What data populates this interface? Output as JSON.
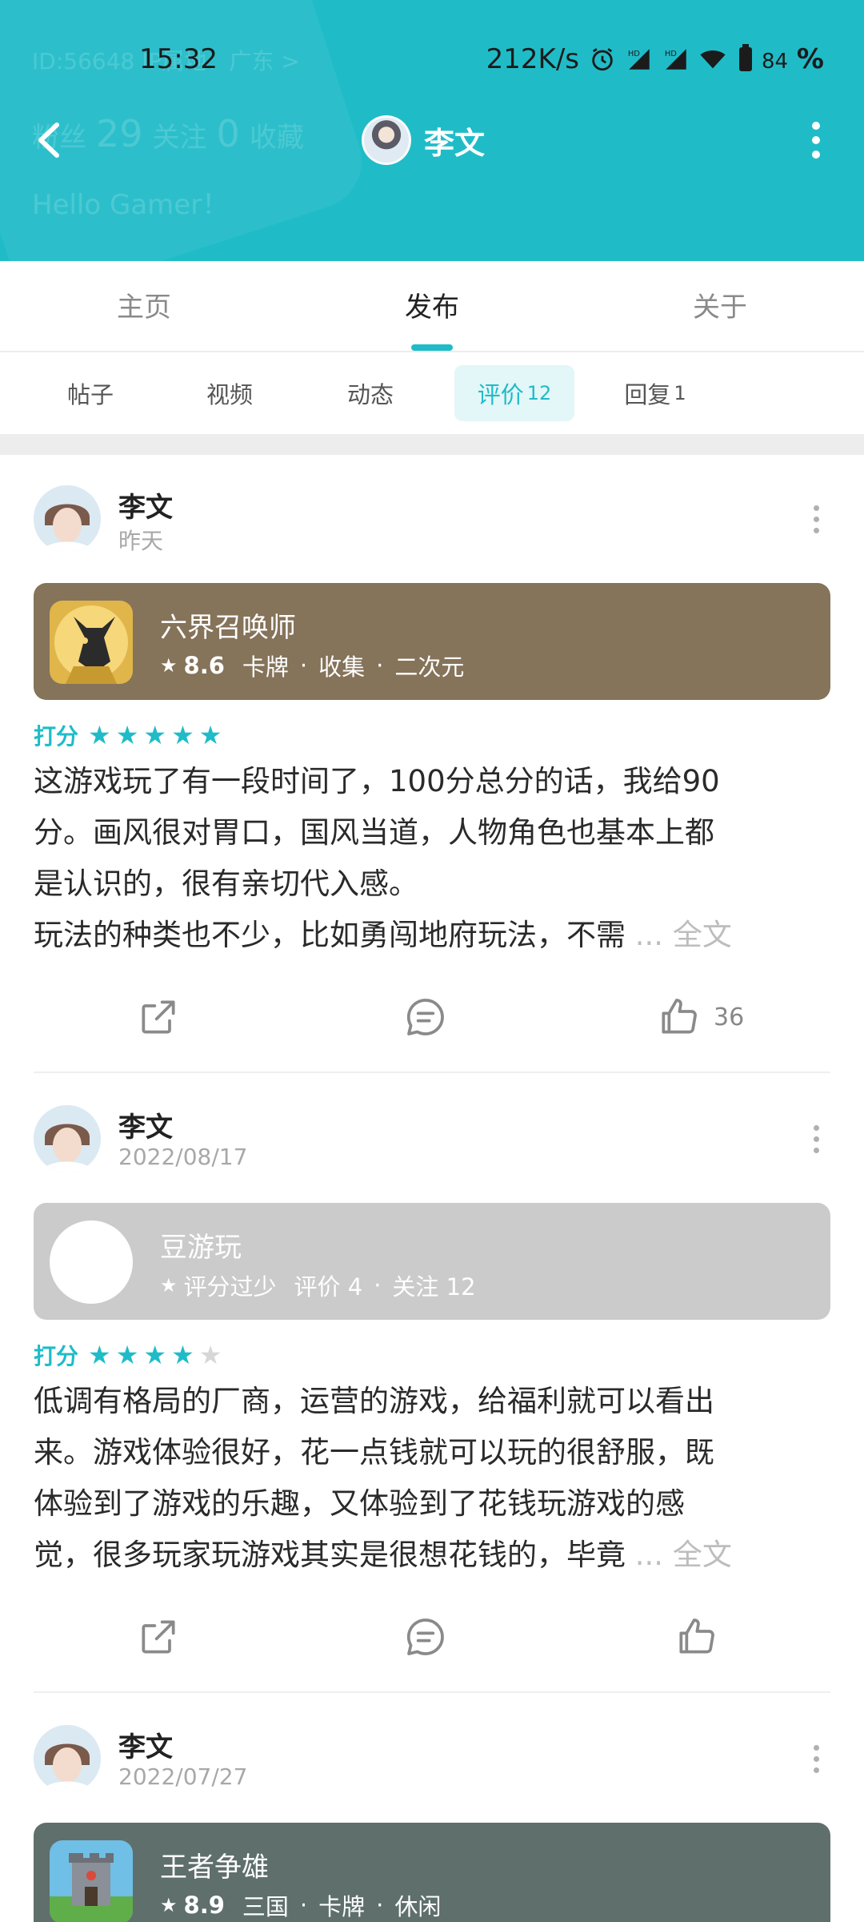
{
  "status_bar": {
    "time": "15:32",
    "net_speed": "212K/s",
    "battery": "84",
    "battery_suffix": "%"
  },
  "profile_ghost": {
    "id_line": "ID:56648  IP属地：广东 >",
    "fans_label": "粉丝",
    "follow_count": "29",
    "follow_label": "关注",
    "fav_count": "0",
    "fav_label": "收藏",
    "bio": "Hello Gamer！"
  },
  "nav": {
    "title": "李文",
    "icons": {
      "back": "chevron-left-icon",
      "more": "more-vertical-icon"
    }
  },
  "main_tabs": [
    {
      "label": "主页"
    },
    {
      "label": "发布",
      "active": true
    },
    {
      "label": "关于"
    }
  ],
  "sub_tabs": [
    {
      "label": "帖子",
      "count": ""
    },
    {
      "label": "视频",
      "count": ""
    },
    {
      "label": "动态",
      "count": ""
    },
    {
      "label": "评价",
      "count": "12",
      "active": true
    },
    {
      "label": "回复",
      "count": "1"
    }
  ],
  "reviews": [
    {
      "user": "李文",
      "date": "昨天",
      "game": {
        "title": "六界召唤师",
        "score": "8.6",
        "tags": [
          "卡牌",
          "收集",
          "二次元"
        ],
        "bg_color": "#85735a"
      },
      "rating_label": "打分",
      "stars": 5,
      "text_lines": [
        "这游戏玩了有一段时间了，100分总分的话，我给90",
        "分。画风很对胃口，国风当道，人物角色也基本上都",
        "是认识的，很有亲切代入感。",
        "玩法的种类也不少，比如勇闯地府玩法，不需"
      ],
      "ellipsis": "...",
      "full_text": "全文",
      "like_count": "36"
    },
    {
      "user": "李文",
      "date": "2022/08/17",
      "game": {
        "title": "豆游玩",
        "score": "评分过少",
        "tags": [
          "评价 4",
          "关注 12"
        ],
        "bg_color": "#cbcbcb"
      },
      "rating_label": "打分",
      "stars": 4,
      "text_lines": [
        "低调有格局的厂商，运营的游戏，给福利就可以看出",
        "来。游戏体验很好，花一点钱就可以玩的很舒服，既",
        "体验到了游戏的乐趣，又体验到了花钱玩游戏的感",
        "觉，很多玩家玩游戏其实是很想花钱的，毕竟"
      ],
      "ellipsis": "...",
      "full_text": "全文",
      "like_count": ""
    },
    {
      "user": "李文",
      "date": "2022/07/27",
      "game": {
        "title": "王者争雄",
        "score": "8.9",
        "tags": [
          "三国",
          "卡牌",
          "休闲"
        ],
        "bg_color": "#5f6f6b"
      }
    }
  ],
  "colors": {
    "accent": "#1fbcc8",
    "tab_active_bg": "#e3f6f8"
  }
}
